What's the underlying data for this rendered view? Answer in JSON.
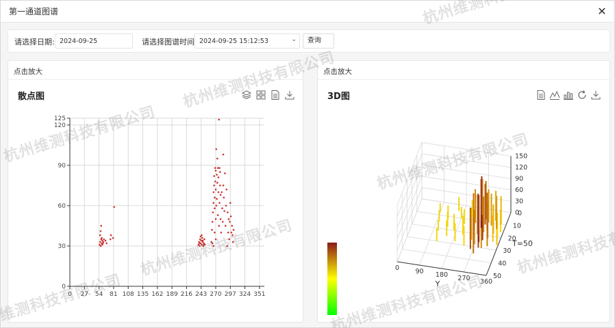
{
  "dialog": {
    "title": "第一通道图谱"
  },
  "filter": {
    "date_label": "请选择日期:",
    "date_value": "2024-09-25",
    "time_label": "请选择图谱时间:",
    "time_value": "2024-09-25 15:12:53",
    "query_label": "查询"
  },
  "left_panel": {
    "zoom_hint": "点击放大",
    "chart_title": "散点图",
    "tools": [
      "layers-icon",
      "grid-icon",
      "document-icon",
      "download-icon"
    ]
  },
  "right_panel": {
    "zoom_hint": "点击放大",
    "chart_title": "3D图",
    "tools": [
      "document-icon",
      "line-chart-icon",
      "bar-chart-icon",
      "refresh-icon",
      "download-icon"
    ]
  },
  "watermark_text": "杭州维测科技有限公司",
  "colors": {
    "point": "#cc3333",
    "grid": "#d9d9d9",
    "axis": "#333333",
    "gradient_top": "#8b1a1a",
    "gradient_mid": "#ffff00",
    "gradient_bottom": "#00ff00"
  },
  "chart_data": [
    {
      "type": "scatter",
      "title": "散点图",
      "x_ticks": [
        "0",
        "27",
        "54",
        "81",
        "108",
        "135",
        "162",
        "189",
        "216",
        "243",
        "270",
        "297",
        "324",
        "351"
      ],
      "y_ticks": [
        "0",
        "30",
        "60",
        "90",
        "120",
        "125"
      ],
      "xlim": [
        0,
        360
      ],
      "ylim": [
        0,
        125
      ],
      "points": [
        [
          55,
          31
        ],
        [
          56,
          33
        ],
        [
          57,
          30
        ],
        [
          58,
          35
        ],
        [
          59,
          32
        ],
        [
          60,
          34
        ],
        [
          56,
          38
        ],
        [
          57,
          41
        ],
        [
          58,
          45
        ],
        [
          59,
          36
        ],
        [
          60,
          31
        ],
        [
          61,
          32
        ],
        [
          62,
          33
        ],
        [
          63,
          35
        ],
        [
          66,
          34
        ],
        [
          68,
          32
        ],
        [
          75,
          35
        ],
        [
          76,
          38
        ],
        [
          80,
          36
        ],
        [
          82,
          59
        ],
        [
          238,
          31
        ],
        [
          239,
          33
        ],
        [
          240,
          30
        ],
        [
          241,
          35
        ],
        [
          242,
          32
        ],
        [
          243,
          34
        ],
        [
          244,
          31
        ],
        [
          245,
          36
        ],
        [
          246,
          33
        ],
        [
          247,
          30
        ],
        [
          248,
          32
        ],
        [
          249,
          35
        ],
        [
          250,
          31
        ],
        [
          242,
          37
        ],
        [
          244,
          38
        ],
        [
          246,
          34
        ],
        [
          240,
          32
        ],
        [
          248,
          31
        ],
        [
          262,
          33
        ],
        [
          263,
          42
        ],
        [
          264,
          48
        ],
        [
          265,
          55
        ],
        [
          266,
          62
        ],
        [
          266,
          70
        ],
        [
          267,
          75
        ],
        [
          267,
          82
        ],
        [
          268,
          58
        ],
        [
          268,
          66
        ],
        [
          269,
          88
        ],
        [
          269,
          78
        ],
        [
          270,
          86
        ],
        [
          270,
          72
        ],
        [
          270,
          50
        ],
        [
          271,
          102
        ],
        [
          271,
          60
        ],
        [
          272,
          83
        ],
        [
          272,
          65
        ],
        [
          273,
          95
        ],
        [
          273,
          77
        ],
        [
          274,
          88
        ],
        [
          274,
          53
        ],
        [
          275,
          81
        ],
        [
          275,
          70
        ],
        [
          276,
          124
        ],
        [
          276,
          45
        ],
        [
          277,
          88
        ],
        [
          277,
          62
        ],
        [
          278,
          85
        ],
        [
          278,
          75
        ],
        [
          279,
          68
        ],
        [
          279,
          50
        ],
        [
          280,
          40
        ],
        [
          281,
          70
        ],
        [
          282,
          58
        ],
        [
          283,
          48
        ],
        [
          284,
          98
        ],
        [
          284,
          75
        ],
        [
          285,
          66
        ],
        [
          286,
          56
        ],
        [
          287,
          84
        ],
        [
          288,
          45
        ],
        [
          289,
          60
        ],
        [
          290,
          72
        ],
        [
          291,
          30
        ],
        [
          292,
          55
        ],
        [
          293,
          40
        ],
        [
          294,
          50
        ],
        [
          295,
          35
        ],
        [
          296,
          48
        ],
        [
          297,
          62
        ],
        [
          298,
          52
        ],
        [
          299,
          40
        ],
        [
          300,
          45
        ],
        [
          301,
          38
        ],
        [
          302,
          33
        ],
        [
          303,
          42
        ],
        [
          264,
          32
        ],
        [
          266,
          30
        ],
        [
          270,
          35
        ],
        [
          268,
          40
        ]
      ]
    },
    {
      "type": "3d-bar",
      "title": "3D图",
      "x_label": "Y",
      "z_label": "T=50",
      "x_ticks": [
        "0",
        "90",
        "180",
        "270",
        "360"
      ],
      "z_ticks": [
        "0",
        "10",
        "20",
        "30",
        "40",
        "50"
      ],
      "y_ticks": [
        "0",
        "30",
        "60",
        "90",
        "120",
        "150"
      ],
      "bars": [
        [
          90,
          8,
          24
        ],
        [
          100,
          15,
          30
        ],
        [
          110,
          22,
          28
        ],
        [
          120,
          30,
          34
        ],
        [
          130,
          12,
          36
        ],
        [
          140,
          18,
          40
        ],
        [
          150,
          25,
          42
        ],
        [
          160,
          5,
          38
        ],
        [
          170,
          20,
          44
        ],
        [
          180,
          10,
          30
        ],
        [
          190,
          28,
          48
        ],
        [
          200,
          14,
          40
        ],
        [
          210,
          22,
          50
        ],
        [
          220,
          8,
          46
        ],
        [
          230,
          30,
          52
        ],
        [
          240,
          12,
          90
        ],
        [
          245,
          18,
          100
        ],
        [
          250,
          25,
          85
        ],
        [
          255,
          5,
          95
        ],
        [
          260,
          32,
          110
        ],
        [
          262,
          10,
          120
        ],
        [
          265,
          20,
          105
        ],
        [
          268,
          28,
          92
        ],
        [
          270,
          15,
          130
        ],
        [
          272,
          22,
          115
        ],
        [
          275,
          8,
          102
        ],
        [
          278,
          35,
          98
        ],
        [
          280,
          12,
          108
        ],
        [
          282,
          26,
          125
        ],
        [
          285,
          18,
          95
        ],
        [
          288,
          30,
          112
        ],
        [
          290,
          10,
          88
        ],
        [
          293,
          24,
          118
        ],
        [
          296,
          16,
          100
        ],
        [
          300,
          30,
          90
        ],
        [
          305,
          12,
          85
        ],
        [
          310,
          22,
          96
        ],
        [
          315,
          8,
          80
        ],
        [
          320,
          28,
          92
        ],
        [
          325,
          18,
          78
        ],
        [
          330,
          14,
          88
        ],
        [
          335,
          24,
          70
        ],
        [
          340,
          10,
          75
        ],
        [
          345,
          20,
          65
        ],
        [
          350,
          16,
          60
        ],
        [
          355,
          26,
          72
        ]
      ]
    }
  ]
}
